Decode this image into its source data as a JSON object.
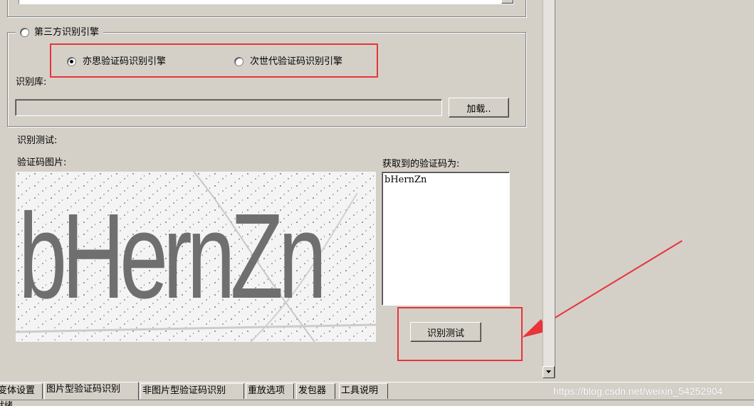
{
  "engine_group": {
    "radio_label": "第三方识别引擎",
    "options": [
      {
        "label": "亦思验证码识别引擎",
        "selected": true
      },
      {
        "label": "次世代验证码识别引擎",
        "selected": false
      }
    ],
    "library_label": "识别库:",
    "library_path": "",
    "load_button": "加载.."
  },
  "test_section": {
    "title": "识别测试:",
    "image_label": "验证码图片:",
    "captcha_text": "bHernZn",
    "result_label": "获取到的验证码为:",
    "result_value": "bHernZn",
    "test_button": "识别测试"
  },
  "tabs": [
    {
      "label": "变体设置",
      "active": false
    },
    {
      "label": "图片型验证码识别",
      "active": true
    },
    {
      "label": "非图片型验证码识别",
      "active": false
    },
    {
      "label": "重放选项",
      "active": false
    },
    {
      "label": "发包器",
      "active": false
    },
    {
      "label": "工具说明",
      "active": false
    }
  ],
  "status_text": "就绪",
  "watermark": "https://blog.csdn.net/weixin_54252904",
  "colors": {
    "window_bg": "#d4d0c8",
    "annotation_red": "#e8343a"
  }
}
